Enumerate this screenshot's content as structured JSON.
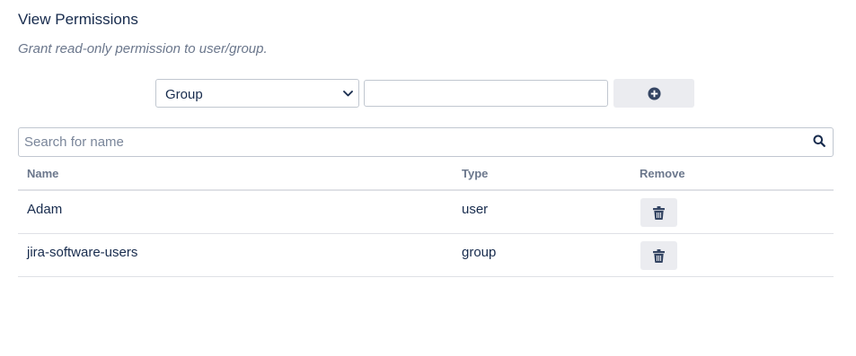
{
  "header": {
    "title": "View Permissions",
    "subtitle": "Grant read-only permission to user/group."
  },
  "add_form": {
    "type_select": {
      "selected": "Group",
      "options": [
        "Group"
      ]
    },
    "name_input": {
      "value": "",
      "placeholder": ""
    },
    "add_button_icon": "plus-circle-icon"
  },
  "search": {
    "placeholder": "Search for name",
    "value": "",
    "icon": "search-icon"
  },
  "table": {
    "columns": {
      "name": "Name",
      "type": "Type",
      "remove": "Remove"
    },
    "rows": [
      {
        "name": "Adam",
        "type": "user",
        "remove_icon": "trash-icon"
      },
      {
        "name": "jira-software-users",
        "type": "group",
        "remove_icon": "trash-icon"
      }
    ]
  },
  "colors": {
    "text_primary": "#172b4d",
    "text_secondary": "#6b778c",
    "button_bg": "#ebecf0",
    "border": "#c1c7d0",
    "divider": "#dfe1e6",
    "icon": "#344563"
  }
}
